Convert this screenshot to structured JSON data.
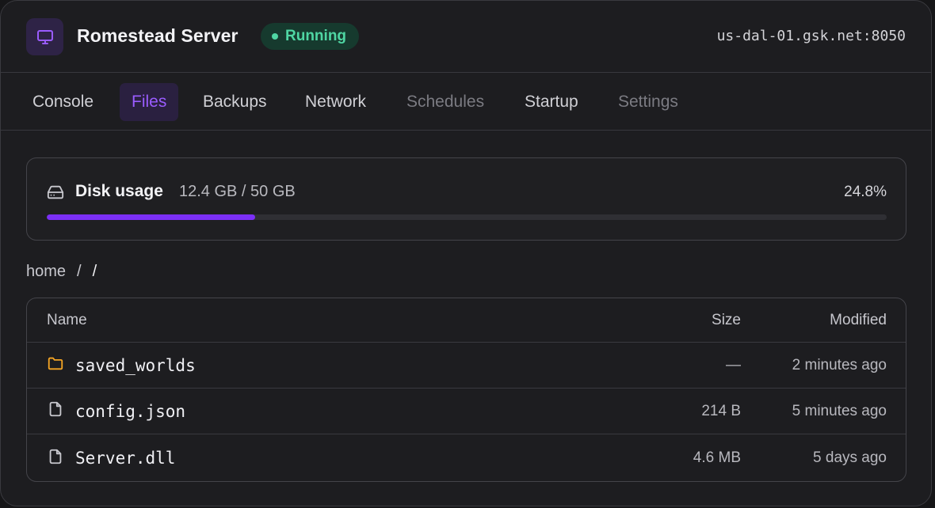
{
  "header": {
    "server_name": "Romestead Server",
    "status": "Running",
    "address": "us-dal-01.gsk.net:8050",
    "icon": "monitor-icon"
  },
  "tabs": [
    {
      "label": "Console",
      "state": "normal"
    },
    {
      "label": "Files",
      "state": "active"
    },
    {
      "label": "Backups",
      "state": "normal"
    },
    {
      "label": "Network",
      "state": "normal"
    },
    {
      "label": "Schedules",
      "state": "disabled"
    },
    {
      "label": "Startup",
      "state": "normal"
    },
    {
      "label": "Settings",
      "state": "disabled"
    }
  ],
  "disk": {
    "label": "Disk usage",
    "value": "12.4 GB / 50 GB",
    "percent_text": "24.8%",
    "percent": 24.8
  },
  "breadcrumb": {
    "root": "home",
    "separator": "/",
    "current": "/"
  },
  "table": {
    "columns": {
      "name": "Name",
      "size": "Size",
      "modified": "Modified"
    },
    "rows": [
      {
        "name": "saved_worlds",
        "type": "folder",
        "icon": "folder-icon",
        "size": "—",
        "modified": "2 minutes ago"
      },
      {
        "name": "config.json",
        "type": "file",
        "icon": "file-icon",
        "size": "214 B",
        "modified": "5 minutes ago"
      },
      {
        "name": "Server.dll",
        "type": "file",
        "icon": "file-icon",
        "size": "4.6 MB",
        "modified": "5 days ago"
      }
    ]
  },
  "colors": {
    "accent": "#7b2ff7",
    "status_green": "#4fd6a3",
    "folder": "#f5a524"
  }
}
